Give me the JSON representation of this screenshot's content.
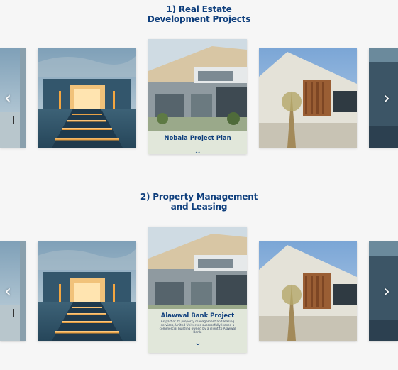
{
  "sections": [
    {
      "title_line1": "1) Real Estate",
      "title_line2": "Development Projects",
      "active_caption": {
        "title": "Nobala Project Plan",
        "description": ""
      }
    },
    {
      "title_line1": "2) Property Management",
      "title_line2": "and Leasing",
      "active_caption": {
        "title": "Alawwal Bank Project",
        "description": "As part of its property management and leasing services, United Universes successfully leased a commercial building owned by a client to Alawwal Bank."
      }
    }
  ],
  "icons": {
    "prev": "‹",
    "next": "›",
    "expand": "⌄"
  },
  "colors": {
    "title": "#0f3f7d",
    "background": "#f6f6f6"
  }
}
